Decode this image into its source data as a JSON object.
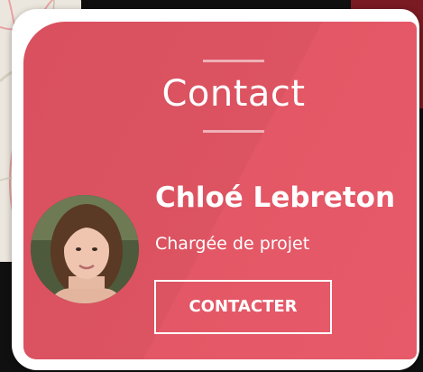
{
  "contact_card": {
    "title": "Contact",
    "person_name": "Chloé Lebreton",
    "person_role": "Chargée de projet",
    "button_label": "CONTACTER",
    "avatar_icon": "person-photo",
    "colors": {
      "card_red": "#e05766",
      "card_red_dark": "#d9505f",
      "text": "#ffffff",
      "frame": "#ffffff",
      "background": "#101010"
    }
  }
}
